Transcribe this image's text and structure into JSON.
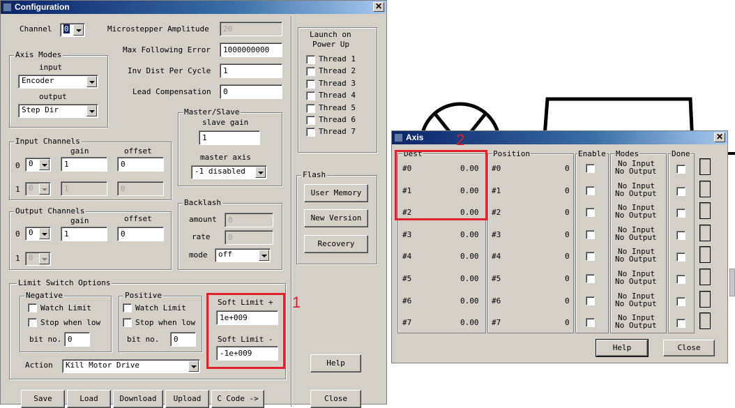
{
  "config": {
    "title": "Configuration",
    "channel": {
      "label": "Channel",
      "value": "0"
    },
    "microstepper": {
      "label": "Microstepper Amplitude",
      "value": "20"
    },
    "max_following_error": {
      "label": "Max Following Error",
      "value": "1000000000"
    },
    "inv_dist_per_cycle": {
      "label": "Inv Dist Per Cycle",
      "value": "1"
    },
    "lead_compensation": {
      "label": "Lead Compensation",
      "value": "0"
    },
    "axis_modes": {
      "title": "Axis Modes",
      "input_label": "input",
      "input_value": "Encoder",
      "output_label": "output",
      "output_value": "Step Dir"
    },
    "master_slave": {
      "title": "Master/Slave",
      "slave_gain_label": "slave gain",
      "slave_gain_value": "1",
      "master_axis_label": "master axis",
      "master_axis_value": "-1 disabled"
    },
    "input_channels": {
      "title": "Input Channels",
      "gain_label": "gain",
      "offset_label": "offset",
      "row0_index": "0",
      "row0_channel": "0",
      "row0_gain": "1",
      "row0_offset": "0",
      "row1_index": "1",
      "row1_channel": "0",
      "row1_gain": "1",
      "row1_offset": "0"
    },
    "output_channels": {
      "title": "Output Channels",
      "gain_label": "gain",
      "offset_label": "offset",
      "row0_index": "0",
      "row0_channel": "0",
      "row0_gain": "1",
      "row0_offset": "0",
      "row1_index": "1",
      "row1_channel": "0"
    },
    "backlash": {
      "title": "Backlash",
      "amount_label": "amount",
      "amount_value": "0",
      "rate_label": "rate",
      "rate_value": "0",
      "mode_label": "mode",
      "mode_value": "off"
    },
    "limit_switch": {
      "title": "Limit Switch Options",
      "negative": {
        "title": "Negative",
        "watch_limit": "Watch Limit",
        "stop_when_low": "Stop when low",
        "bit_no_label": "bit no.",
        "bit_no_value": "0"
      },
      "positive": {
        "title": "Positive",
        "watch_limit": "Watch Limit",
        "stop_when_low": "Stop when low",
        "bit_no_label": "bit no.",
        "bit_no_value": "0"
      },
      "soft_limit_plus_label": "Soft Limit +",
      "soft_limit_plus_value": "1e+009",
      "soft_limit_minus_label": "Soft Limit -",
      "soft_limit_minus_value": "-1e+009",
      "action_label": "Action",
      "action_value": "Kill Motor Drive"
    },
    "launch": {
      "title_line1": "Launch on",
      "title_line2": "Power Up",
      "threads": [
        "Thread 1",
        "Thread 2",
        "Thread 3",
        "Thread 4",
        "Thread 5",
        "Thread 6",
        "Thread 7"
      ]
    },
    "flash": {
      "title": "Flash",
      "user_memory": "User Memory",
      "new_version": "New Version",
      "recovery": "Recovery"
    },
    "help_button": "Help",
    "bottom_buttons": [
      "Save",
      "Load",
      "Download",
      "Upload",
      "C Code ->"
    ],
    "close_button": "Close"
  },
  "axis": {
    "title": "Axis",
    "headers": {
      "dest": "Dest",
      "position": "Position",
      "enable": "Enable",
      "modes": "Modes",
      "done": "Done"
    },
    "rows": [
      {
        "dest_id": "#0",
        "dest_val": "0.00",
        "pos_id": "#0",
        "pos_val": "0",
        "mode_in": "No Input",
        "mode_out": "No Output"
      },
      {
        "dest_id": "#1",
        "dest_val": "0.00",
        "pos_id": "#1",
        "pos_val": "0",
        "mode_in": "No Input",
        "mode_out": "No Output"
      },
      {
        "dest_id": "#2",
        "dest_val": "0.00",
        "pos_id": "#2",
        "pos_val": "0",
        "mode_in": "No Input",
        "mode_out": "No Output"
      },
      {
        "dest_id": "#3",
        "dest_val": "0.00",
        "pos_id": "#3",
        "pos_val": "0",
        "mode_in": "No Input",
        "mode_out": "No Output"
      },
      {
        "dest_id": "#4",
        "dest_val": "0.00",
        "pos_id": "#4",
        "pos_val": "0",
        "mode_in": "No Input",
        "mode_out": "No Output"
      },
      {
        "dest_id": "#5",
        "dest_val": "0.00",
        "pos_id": "#5",
        "pos_val": "0",
        "mode_in": "No Input",
        "mode_out": "No Output"
      },
      {
        "dest_id": "#6",
        "dest_val": "0.00",
        "pos_id": "#6",
        "pos_val": "0",
        "mode_in": "No Input",
        "mode_out": "No Output"
      },
      {
        "dest_id": "#7",
        "dest_val": "0.00",
        "pos_id": "#7",
        "pos_val": "0",
        "mode_in": "No Input",
        "mode_out": "No Output"
      }
    ],
    "help_button": "Help",
    "close_button": "Close"
  },
  "annotations": {
    "label1": "1",
    "label2": "2",
    "color": "#e0212b"
  }
}
